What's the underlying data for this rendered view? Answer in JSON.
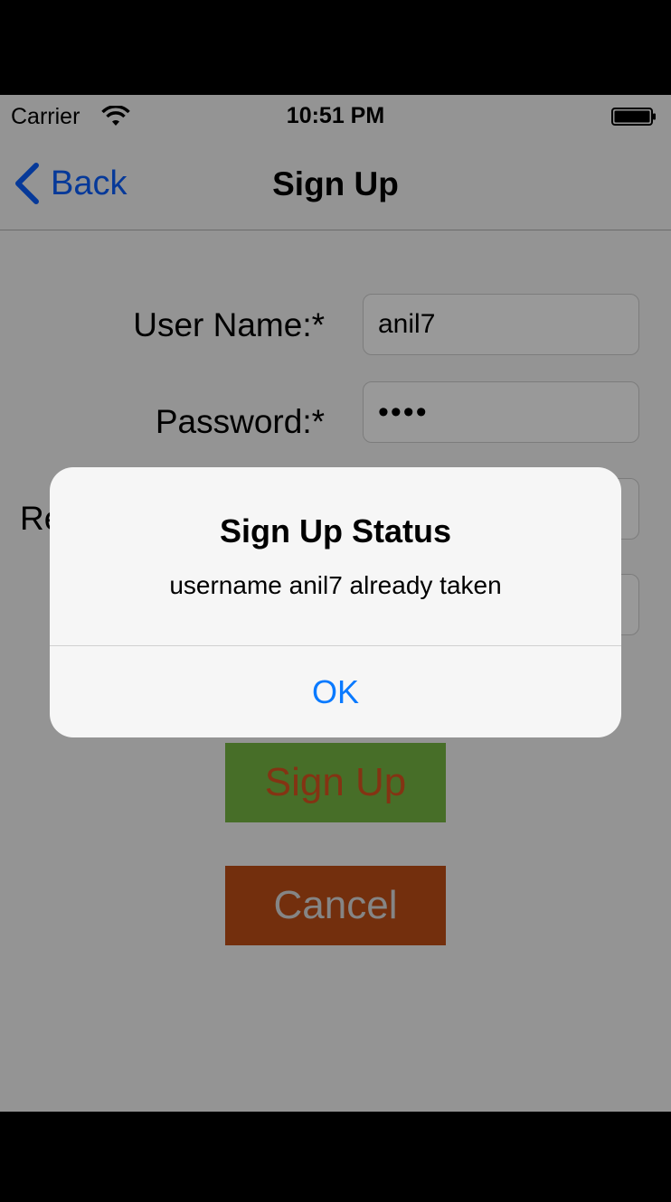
{
  "status_bar": {
    "carrier": "Carrier",
    "time": "10:51 PM"
  },
  "nav": {
    "back_label": "Back",
    "title": "Sign Up"
  },
  "form": {
    "username_label": "User Name:*",
    "username_value": "anil7",
    "password_label": "Password:*",
    "password_value": "••••",
    "partial_label": "Re"
  },
  "buttons": {
    "signup_label": "Sign Up",
    "cancel_label": "Cancel"
  },
  "alert": {
    "title": "Sign Up Status",
    "message": "username anil7 already taken",
    "ok_label": "OK"
  },
  "colors": {
    "tint": "#0a60ff",
    "signup_bg": "#77b843",
    "signup_text": "#dd5520",
    "cancel_bg": "#c04f17",
    "cancel_text": "#dedede",
    "alert_button": "#0a7aff"
  },
  "icons": {
    "wifi": "wifi-icon",
    "battery": "battery-icon",
    "back": "chevron-left-icon"
  }
}
